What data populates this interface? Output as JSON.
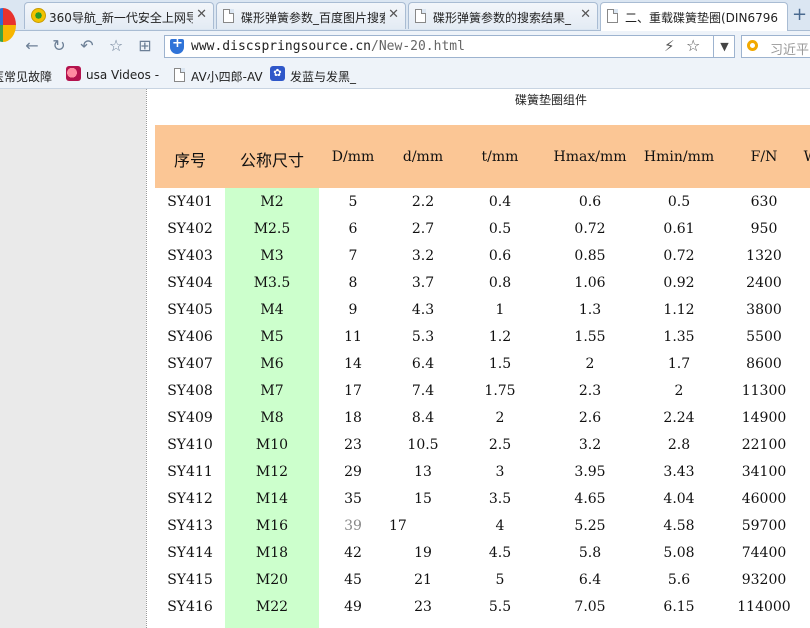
{
  "tabs": [
    {
      "title": "360导航_新一代安全上网导",
      "icon": "360-logo-icon",
      "active": false
    },
    {
      "title": "碟形弹簧参数_百度图片搜索",
      "icon": "page-icon",
      "active": false
    },
    {
      "title": "碟形弹簧参数的搜索结果_",
      "icon": "page-icon",
      "active": false
    },
    {
      "title": "二、重载碟簧垫圈(DIN6796",
      "icon": "page-icon",
      "active": true
    }
  ],
  "address_bar": {
    "domain": "www.discspringsource.cn",
    "path": "/New-20.html"
  },
  "search_bar": {
    "placeholder": "习近平"
  },
  "bookmarks": [
    {
      "label": "医常见故障",
      "icon": "none"
    },
    {
      "label": "usa Videos -",
      "icon": "face-icon"
    },
    {
      "label": "AV小四郎-AV",
      "icon": "page-icon"
    },
    {
      "label": "发蓝与发黑_",
      "icon": "paw-icon"
    }
  ],
  "page": {
    "caption": "碟簧垫圈组件"
  },
  "table": {
    "headers": [
      "序号",
      "公称尺寸",
      "D/mm",
      "d/mm",
      "t/mm",
      "Hmax/mm",
      "Hmin/mm",
      "F/N",
      "W"
    ],
    "rows": [
      [
        "SY401",
        "M2",
        "5",
        "2.2",
        "0.4",
        "0.6",
        "0.5",
        "630"
      ],
      [
        "SY402",
        "M2.5",
        "6",
        "2.7",
        "0.5",
        "0.72",
        "0.61",
        "950"
      ],
      [
        "SY403",
        "M3",
        "7",
        "3.2",
        "0.6",
        "0.85",
        "0.72",
        "1320"
      ],
      [
        "SY404",
        "M3.5",
        "8",
        "3.7",
        "0.8",
        "1.06",
        "0.92",
        "2400"
      ],
      [
        "SY405",
        "M4",
        "9",
        "4.3",
        "1",
        "1.3",
        "1.12",
        "3800"
      ],
      [
        "SY406",
        "M5",
        "11",
        "5.3",
        "1.2",
        "1.55",
        "1.35",
        "5500"
      ],
      [
        "SY407",
        "M6",
        "14",
        "6.4",
        "1.5",
        "2",
        "1.7",
        "8600"
      ],
      [
        "SY408",
        "M7",
        "17",
        "7.4",
        "1.75",
        "2.3",
        "2",
        "11300"
      ],
      [
        "SY409",
        "M8",
        "18",
        "8.4",
        "2",
        "2.6",
        "2.24",
        "14900"
      ],
      [
        "SY410",
        "M10",
        "23",
        "10.5",
        "2.5",
        "3.2",
        "2.8",
        "22100"
      ],
      [
        "SY411",
        "M12",
        "29",
        "13",
        "3",
        "3.95",
        "3.43",
        "34100"
      ],
      [
        "SY412",
        "M14",
        "35",
        "15",
        "3.5",
        "4.65",
        "4.04",
        "46000"
      ],
      [
        "SY413",
        "M16",
        "39",
        "17",
        "4",
        "5.25",
        "4.58",
        "59700"
      ],
      [
        "SY414",
        "M18",
        "42",
        "19",
        "4.5",
        "5.8",
        "5.08",
        "74400"
      ],
      [
        "SY415",
        "M20",
        "45",
        "21",
        "5",
        "6.4",
        "5.6",
        "93200"
      ],
      [
        "SY416",
        "M22",
        "49",
        "23",
        "5.5",
        "7.05",
        "6.15",
        "114000"
      ]
    ]
  },
  "colors": {
    "header_bg": "#fbc695",
    "size_column_bg": "#ccffcc",
    "tab_strip": "#dbe6f2"
  }
}
